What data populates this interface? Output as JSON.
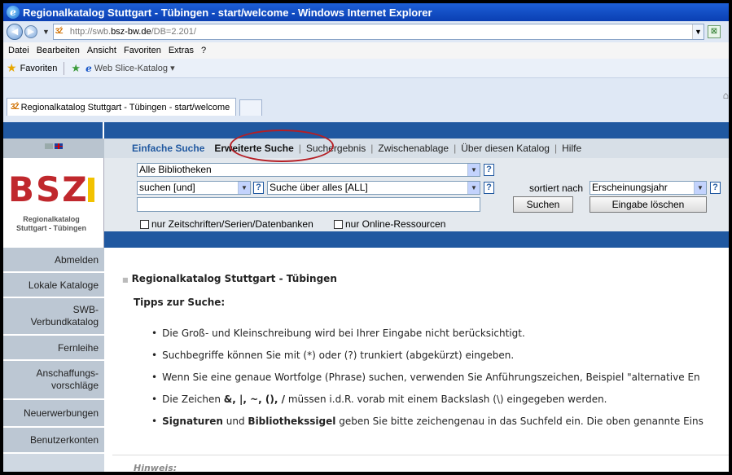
{
  "window": {
    "title": "Regionalkatalog Stuttgart - Tübingen - start/welcome - Windows Internet Explorer"
  },
  "address": {
    "proto": "http://swb.",
    "host": "bsz-bw.de",
    "path": "/DB=2.201/"
  },
  "menu": [
    "Datei",
    "Bearbeiten",
    "Ansicht",
    "Favoriten",
    "Extras",
    "?"
  ],
  "favorites": {
    "label": "Favoriten",
    "webslice": "Web Slice-Katalog ▾"
  },
  "tab": {
    "title": "Regionalkatalog Stuttgart - Tübingen - start/welcome"
  },
  "logo": {
    "text": "BSZ",
    "sub1": "Regionalkatalog",
    "sub2": "Stuttgart - Tübingen"
  },
  "nav": [
    {
      "label": "Abmelden"
    },
    {
      "label": "Lokale Kataloge"
    },
    {
      "label": "SWB-\nVerbundkatalog"
    },
    {
      "label": "Fernleihe"
    },
    {
      "label": "Anschaffungs-\nvorschläge"
    },
    {
      "label": "Neuerwerbungen"
    },
    {
      "label": "Benutzerkonten"
    }
  ],
  "tabs": {
    "einfach": "Einfache Suche",
    "erweitert": "Erweiterte Suche",
    "ergebnis": "Suchergebnis",
    "ablage": "Zwischenablage",
    "ueber": "Über diesen Katalog",
    "hilfe": "Hilfe"
  },
  "search": {
    "library": "Alle Bibliotheken",
    "operator": "suchen [und]",
    "field": "Suche über alles [ALL]",
    "sort_label": "sortiert nach",
    "sort_value": "Erscheinungsjahr",
    "query": "",
    "submit": "Suchen",
    "clear": "Eingabe löschen",
    "chk1": "nur Zeitschriften/Serien/Datenbanken",
    "chk2": "nur Online-Ressourcen",
    "help": "?"
  },
  "content": {
    "title": "Regionalkatalog Stuttgart - Tübingen",
    "subtitle": "Tipps zur Suche:",
    "tip1": "Die Groß- und Kleinschreibung wird bei Ihrer Eingabe nicht berücksichtigt.",
    "tip2": "Suchbegriffe können Sie mit (*) oder (?) trunkiert (abgekürzt) eingeben.",
    "tip3": "Wenn Sie eine genaue Wortfolge (Phrase) suchen, verwenden Sie Anführungszeichen, Beispiel \"alternative En",
    "tip4_a": "Die Zeichen ",
    "tip4_b": "&, |, ~, (), /",
    "tip4_c": " müssen i.d.R. vorab mit einem Backslash (\\) eingegeben werden.",
    "tip5_a": "Signaturen",
    "tip5_b": " und ",
    "tip5_c": "Bibliothekssigel",
    "tip5_d": " geben Sie bitte zeichengenau in das Suchfeld ein. Die oben genannte Eins",
    "hinweis": "Hinweis:"
  },
  "colors": {
    "accent": "#2058a0",
    "circle": "#b51e24"
  }
}
